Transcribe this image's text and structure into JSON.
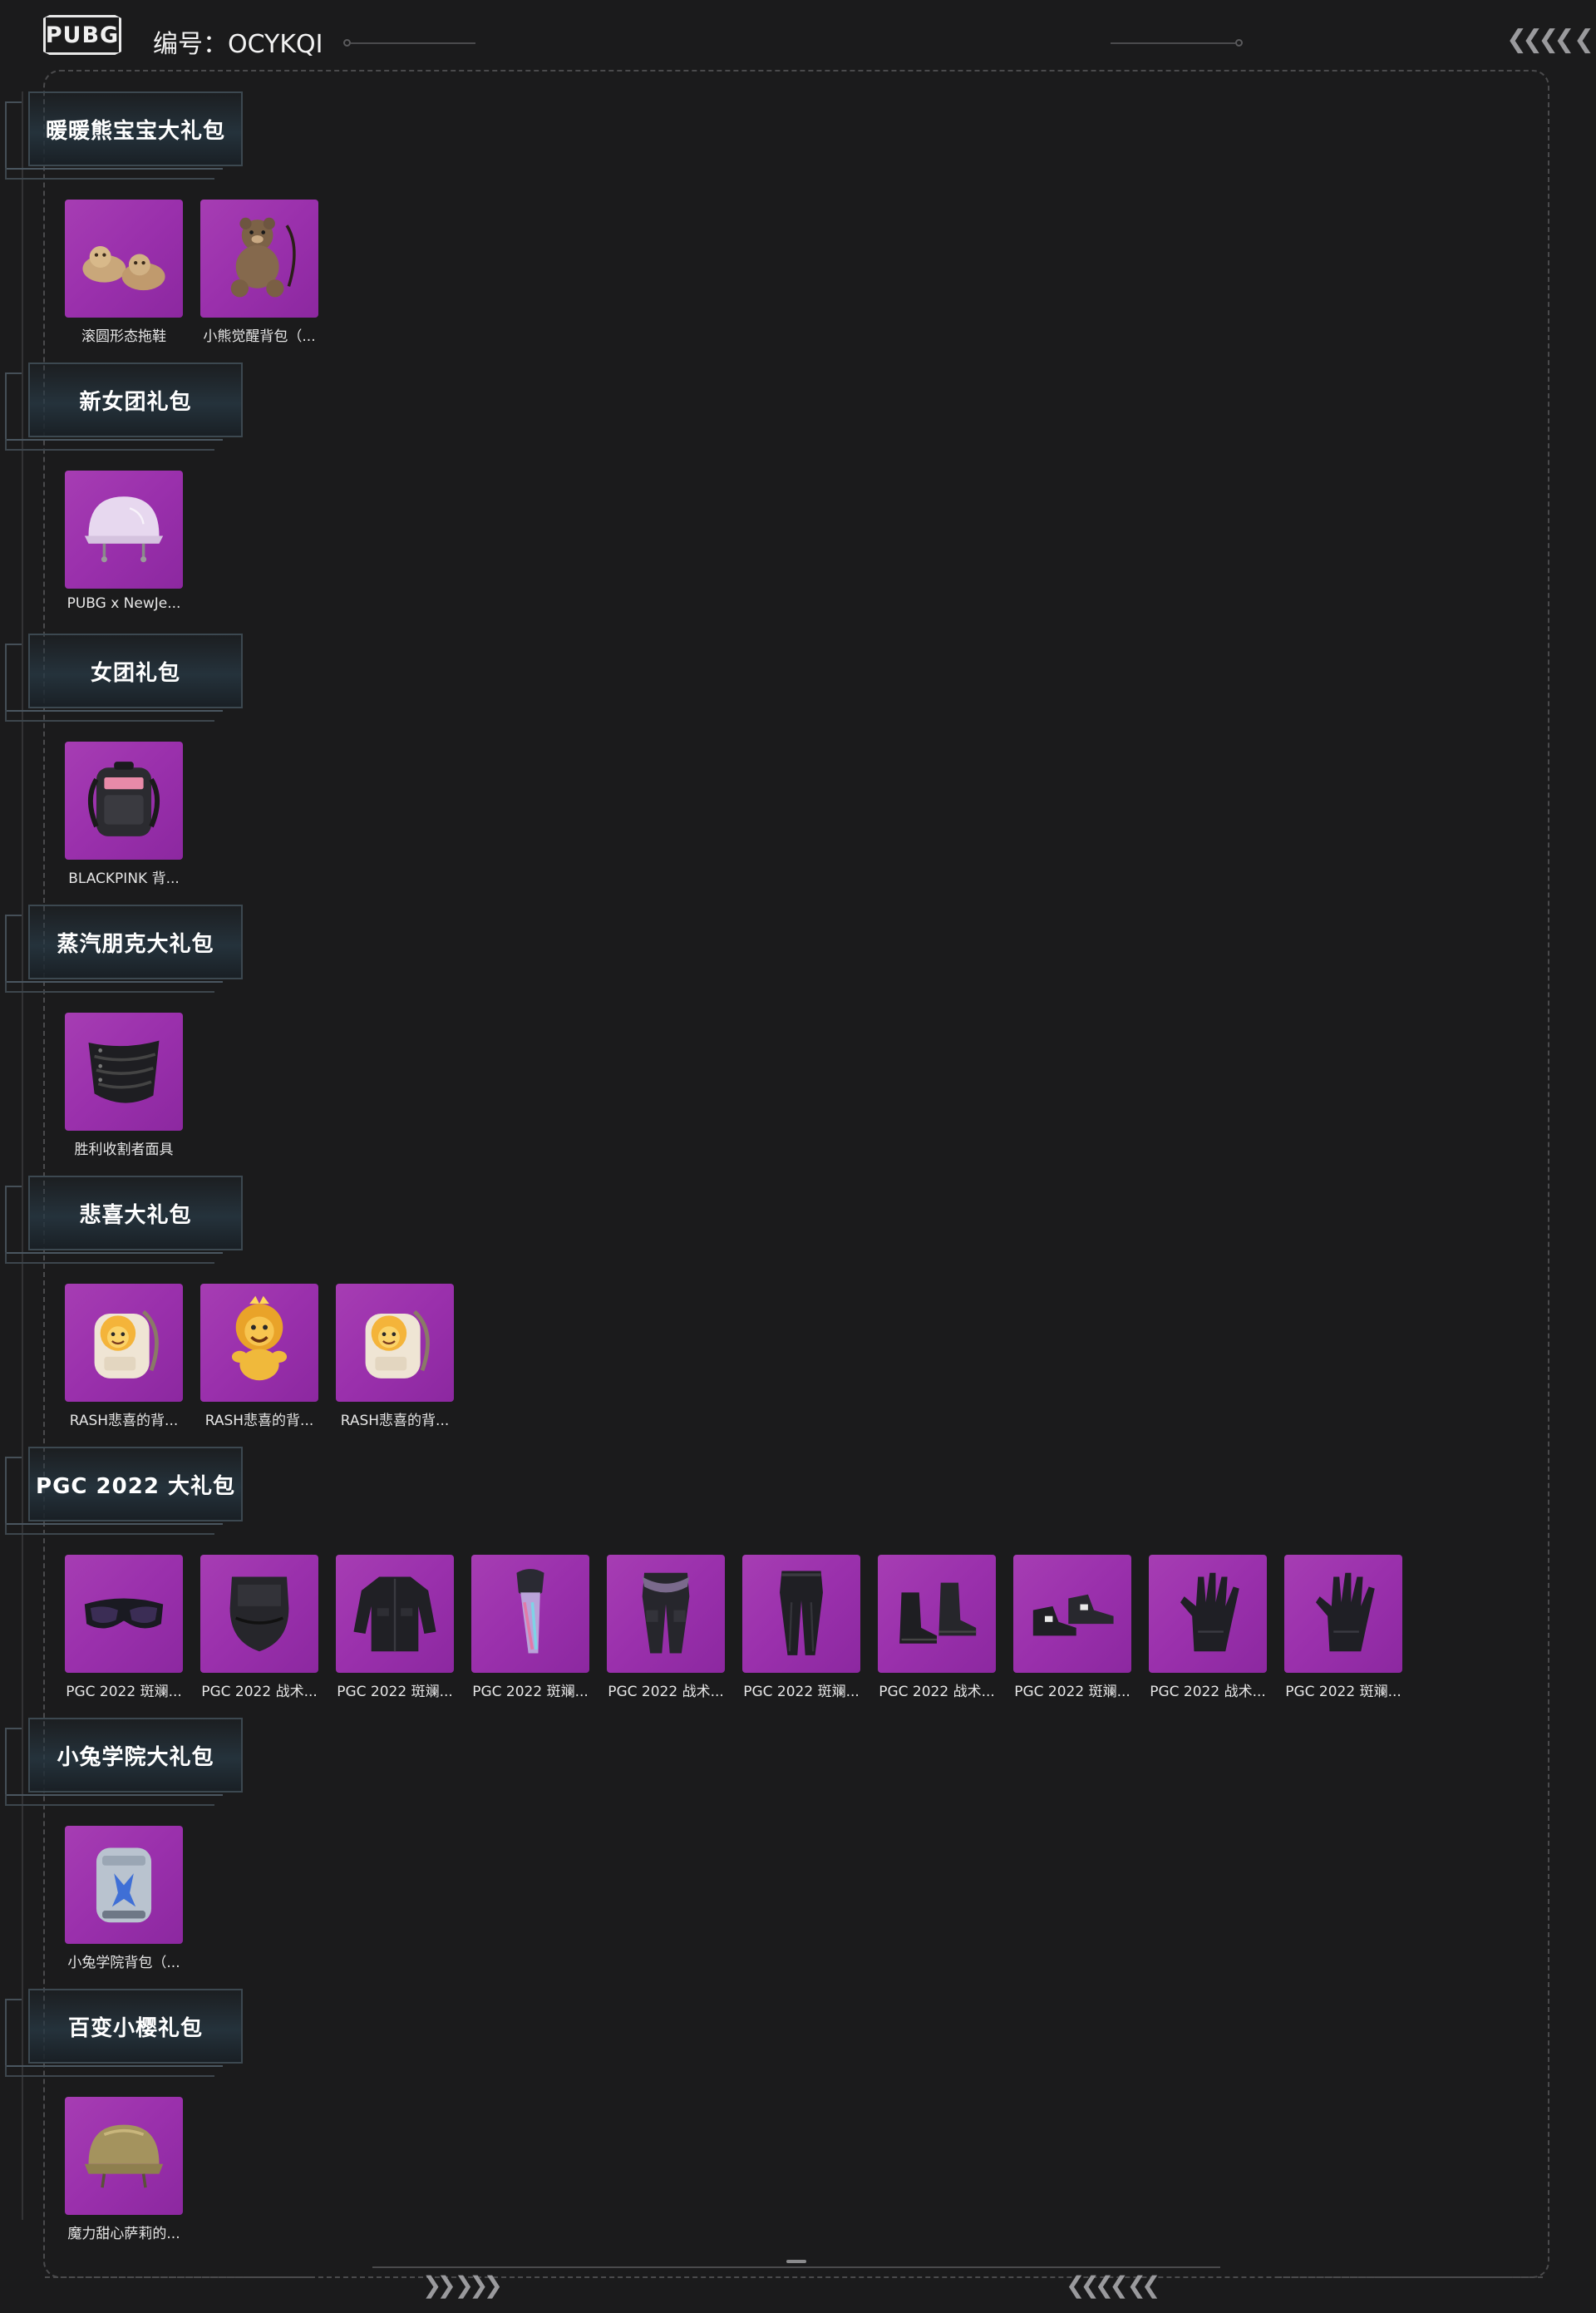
{
  "header": {
    "logo_text": "PUBG",
    "account_label": "编号：OCYKQI"
  },
  "sections": [
    {
      "title": "暖暖熊宝宝大礼包",
      "items": [
        {
          "label": "滚圆形态拖鞋",
          "icon": "slippers-icon"
        },
        {
          "label": "小熊觉醒背包（...",
          "icon": "teddy-bear-backpack-icon"
        }
      ]
    },
    {
      "title": "新女团礼包",
      "items": [
        {
          "label": "PUBG x NewJe...",
          "icon": "helmet-icon"
        }
      ]
    },
    {
      "title": "女团礼包",
      "items": [
        {
          "label": "BLACKPINK 背...",
          "icon": "backpack-icon"
        }
      ]
    },
    {
      "title": "蒸汽朋克大礼包",
      "items": [
        {
          "label": "胜利收割者面具",
          "icon": "mask-icon"
        }
      ]
    },
    {
      "title": "悲喜大礼包",
      "items": [
        {
          "label": "RASH悲喜的背...",
          "icon": "lion-backpack-icon"
        },
        {
          "label": "RASH悲喜的背...",
          "icon": "lion-plush-icon"
        },
        {
          "label": "RASH悲喜的背...",
          "icon": "lion-backpack-icon"
        }
      ]
    },
    {
      "title": "PGC 2022 大礼包",
      "items": [
        {
          "label": "PGC 2022 斑斓...",
          "icon": "goggles-icon"
        },
        {
          "label": "PGC 2022 战术...",
          "icon": "face-mask-icon"
        },
        {
          "label": "PGC 2022 斑斓...",
          "icon": "jacket-icon"
        },
        {
          "label": "PGC 2022 斑斓...",
          "icon": "scarf-icon"
        },
        {
          "label": "PGC 2022 战术...",
          "icon": "tactical-pants-icon"
        },
        {
          "label": "PGC 2022 斑斓...",
          "icon": "pants-icon"
        },
        {
          "label": "PGC 2022 战术...",
          "icon": "boots-icon"
        },
        {
          "label": "PGC 2022 斑斓...",
          "icon": "shoes-icon"
        },
        {
          "label": "PGC 2022 战术...",
          "icon": "glove-icon"
        },
        {
          "label": "PGC 2022 斑斓...",
          "icon": "glove-icon"
        }
      ]
    },
    {
      "title": "小兔学院大礼包",
      "items": [
        {
          "label": "小兔学院背包（...",
          "icon": "rabbit-backpack-icon"
        }
      ]
    },
    {
      "title": "百变小樱礼包",
      "items": [
        {
          "label": "魔力甜心萨莉的...",
          "icon": "gold-helmet-icon"
        }
      ]
    }
  ],
  "colors": {
    "background": "#1b1b1c",
    "thumb": "#9a30ac",
    "frame": "#4a4a4c"
  }
}
